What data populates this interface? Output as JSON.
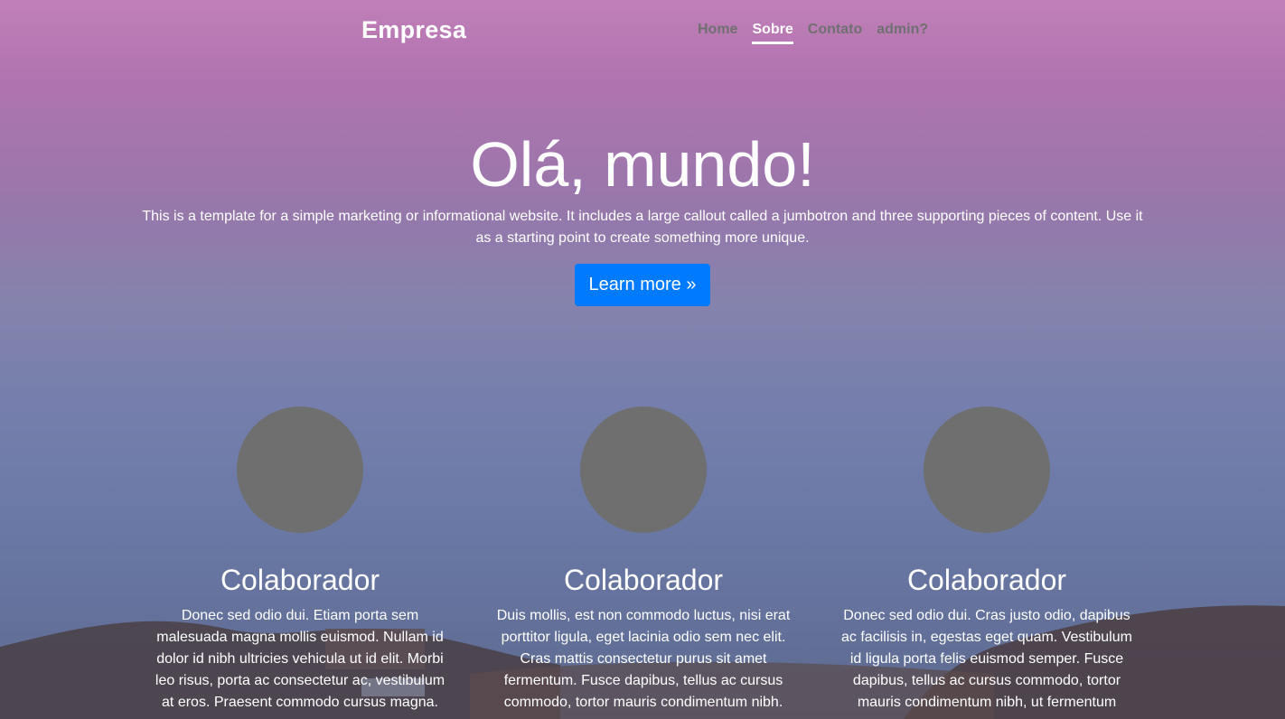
{
  "nav": {
    "brand": "Empresa",
    "links": [
      {
        "label": "Home"
      },
      {
        "label": "Sobre"
      },
      {
        "label": "Contato"
      },
      {
        "label": "admin?"
      }
    ]
  },
  "hero": {
    "title": "Olá, mundo!",
    "lead": "This is a template for a simple marketing or informational website. It includes a large callout called a jumbotron and three supporting pieces of content. Use it as a starting point to create something more unique.",
    "button": "Learn more »"
  },
  "columns": [
    {
      "heading": "Colaborador",
      "text": "Donec sed odio dui. Etiam porta sem malesuada magna mollis euismod. Nullam id dolor id nibh ultricies vehicula ut id elit. Morbi leo risus, porta ac consectetur ac, vestibulum at eros. Praesent commodo cursus magna."
    },
    {
      "heading": "Colaborador",
      "text": "Duis mollis, est non commodo luctus, nisi erat porttitor ligula, eget lacinia odio sem nec elit. Cras mattis consectetur purus sit amet fermentum. Fusce dapibus, tellus ac cursus commodo, tortor mauris condimentum nibh."
    },
    {
      "heading": "Colaborador",
      "text": "Donec sed odio dui. Cras justo odio, dapibus ac facilisis in, egestas eget quam. Vestibulum id ligula porta felis euismod semper. Fusce dapibus, tellus ac cursus commodo, tortor mauris condimentum nibh, ut fermentum"
    }
  ],
  "colors": {
    "primary_button": "#007bff",
    "avatar_placeholder": "#6f6f6f",
    "nav_inactive": "#707070"
  }
}
